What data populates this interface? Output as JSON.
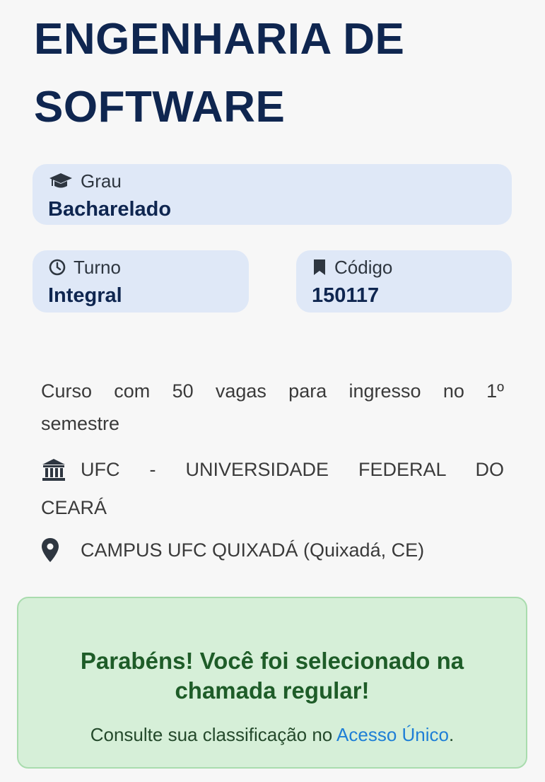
{
  "course": {
    "title_line1": "ENGENHARIA DE",
    "title_line2": "SOFTWARE"
  },
  "grau": {
    "label": "Grau",
    "value": "Bacharelado",
    "icon": "graduation-cap-icon"
  },
  "turno": {
    "label": "Turno",
    "value": "Integral",
    "icon": "clock-icon"
  },
  "codigo": {
    "label": "Código",
    "value": "150117",
    "icon": "bookmark-icon"
  },
  "description": {
    "line1": "Curso com 50 vagas para ingresso no 1º",
    "line2": "semestre"
  },
  "institution": {
    "line1": "UFC - UNIVERSIDADE FEDERAL DO",
    "line2": "CEARÁ",
    "icon": "institution-icon"
  },
  "campus": {
    "text": "CAMPUS UFC QUIXADÁ (Quixadá, CE)",
    "icon": "map-pin-icon"
  },
  "result": {
    "headline_line1": "Parabéns! Você foi selecionado na",
    "headline_line2": "chamada regular!",
    "sub_prefix": "Consulte sua classificação no ",
    "link": "Acesso Único",
    "sub_suffix": "."
  },
  "colors": {
    "title": "#0f2650",
    "card_bg": "#dfe8f7",
    "banner_bg": "#d6efd8",
    "banner_text": "#1e5c28",
    "link": "#1e7fd6"
  }
}
